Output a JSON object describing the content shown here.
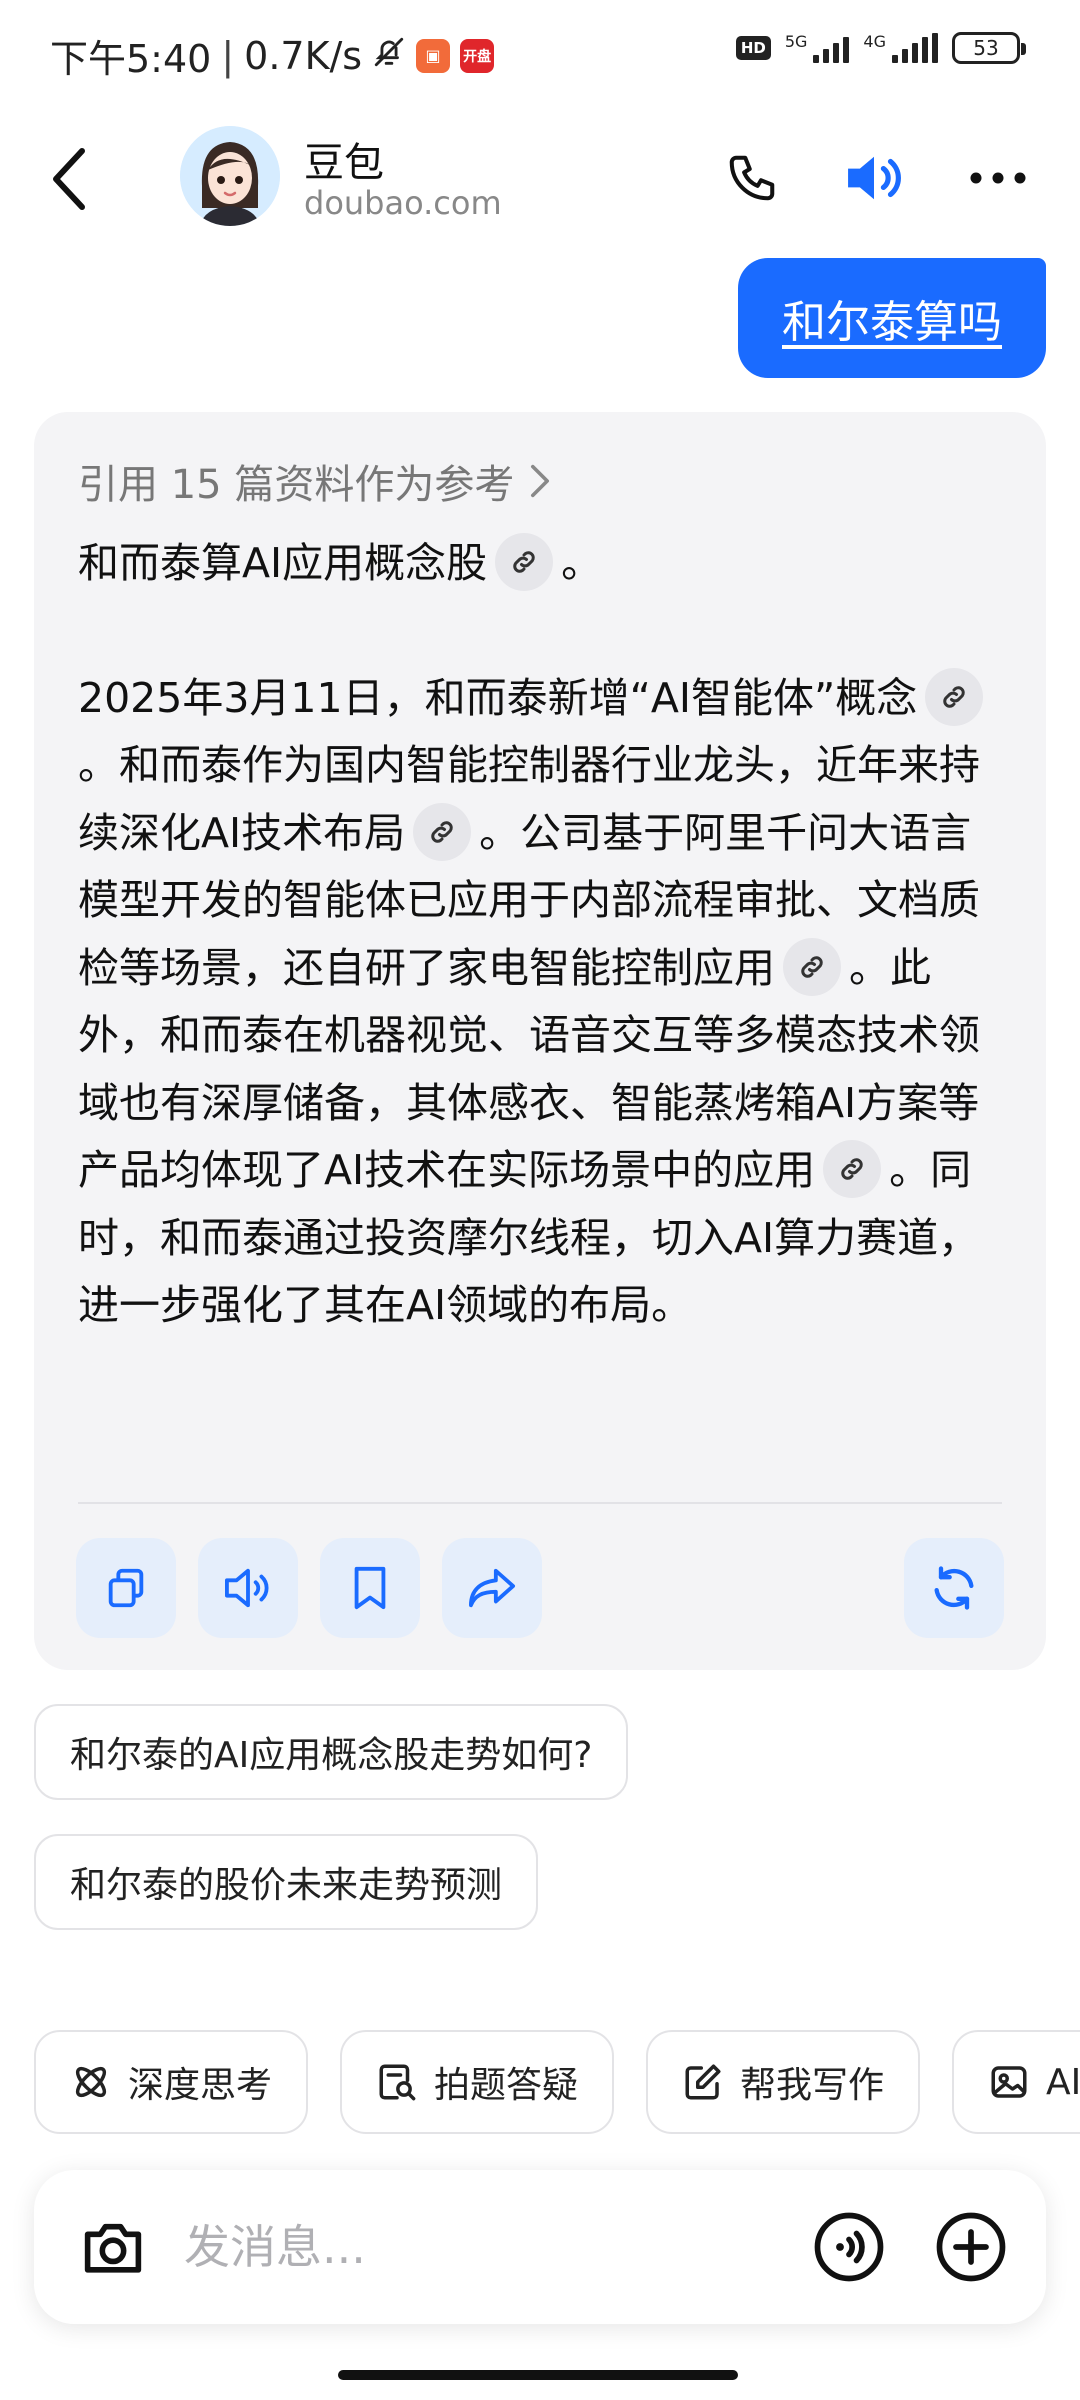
{
  "status_bar": {
    "time": "下午5:40",
    "speed": "0.7K/s",
    "network_1": "5G",
    "network_2": "4G",
    "hd": "HD",
    "battery": "53",
    "badge_app": "开盘",
    "icons": [
      "bell-off-icon",
      "orange-app-icon",
      "red-app-icon",
      "signal-icon",
      "battery-icon"
    ]
  },
  "header": {
    "name": "豆包",
    "domain": "doubao.com",
    "icons": [
      "back-icon",
      "phone-icon",
      "speaker-icon",
      "more-icon"
    ],
    "accent": "#1a6bff"
  },
  "user_message": "和尔泰算吗",
  "answer": {
    "reference_text": "引用 15 篇资料作为参考",
    "para1_a": "和而泰算AI应用概念股",
    "para1_b": "。",
    "para2_a": "2025年3月11日，和而泰新增“AI智能体”概念",
    "para2_b": "。和而泰作为国内智能控制器行业龙头，近年来持续深化AI技术布局",
    "para2_c": "。公司基于阿里千问大语言模型开发的智能体已应用于内部流程审批、文档质检等场景，还自研了家电智能控制应用",
    "para2_d": "。此外，和而泰在机器视觉、语音交互等多模态技术领域也有深厚储备，其体感衣、智能蒸烤箱AI方案等产品均体现了AI技术在实际场景中的应用",
    "para2_e": "。同时，和而泰通过投资摩尔线程，切入AI算力赛道，进一步强化了其在AI领域的布局。",
    "actions": [
      "copy-icon",
      "read-aloud-icon",
      "bookmark-icon",
      "share-icon",
      "regenerate-icon"
    ],
    "action_bg": "#e5eefb"
  },
  "suggestions": [
    "和尔泰的AI应用概念股走势如何?",
    "和尔泰的股价未来走势预测"
  ],
  "features": [
    {
      "label": "深度思考",
      "icon": "atom-icon"
    },
    {
      "label": "拍题答疑",
      "icon": "scan-question-icon"
    },
    {
      "label": "帮我写作",
      "icon": "edit-icon"
    },
    {
      "label": "AI",
      "icon": "image-icon"
    }
  ],
  "input": {
    "placeholder": "发消息...",
    "icons": [
      "camera-icon",
      "voice-icon",
      "plus-icon"
    ]
  }
}
